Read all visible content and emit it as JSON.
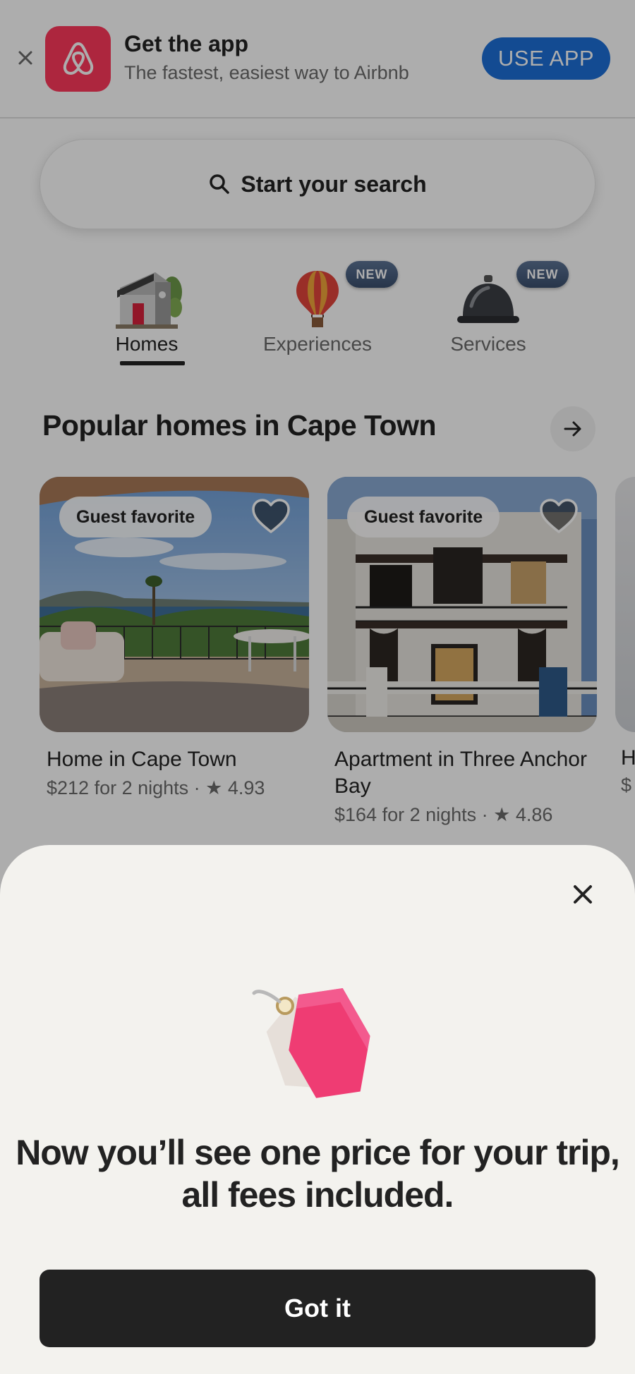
{
  "banner": {
    "title": "Get the app",
    "subtitle": "The fastest, easiest way to Airbnb",
    "cta_label": "USE APP",
    "accent": "#ff385c",
    "cta_color": "#1c6fd8"
  },
  "search": {
    "label": "Start your search",
    "icon": "search-icon"
  },
  "categories": {
    "items": [
      {
        "label": "Homes",
        "icon": "house-icon",
        "active": true,
        "badge": ""
      },
      {
        "label": "Experiences",
        "icon": "hot-air-balloon-icon",
        "active": false,
        "badge": "NEW"
      },
      {
        "label": "Services",
        "icon": "service-bell-icon",
        "active": false,
        "badge": "NEW"
      }
    ]
  },
  "popular": {
    "title": "Popular homes in Cape Town",
    "listings": [
      {
        "badge": "Guest favorite",
        "title": "Home in Cape Town",
        "price": "$212 for 2 nights",
        "separator": " · ",
        "rating": "★ 4.93"
      },
      {
        "badge": "Guest favorite",
        "title": "Apartment in Three Anchor Bay",
        "price": "$164 for 2 nights",
        "separator": " · ",
        "rating": "★ 4.86"
      }
    ],
    "peek": {
      "title": "H",
      "meta": "$"
    }
  },
  "sheet": {
    "heading": "Now you’ll see one price for your trip, all fees included.",
    "button_label": "Got it",
    "illustration": "price-tag-icon"
  }
}
